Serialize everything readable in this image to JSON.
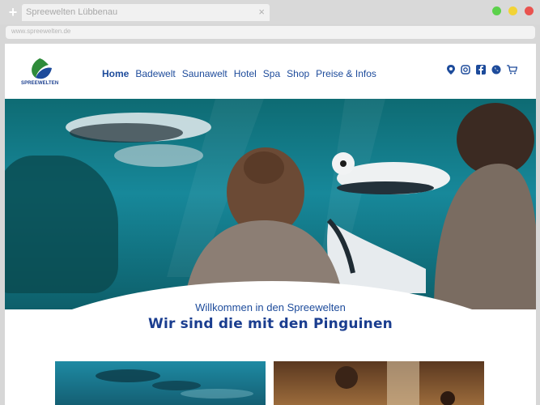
{
  "browser": {
    "tab_title": "Spreewelten Lübbenau",
    "tab_close": "×",
    "new_tab": "+",
    "url": "www.spreewelten.de",
    "controls": {
      "green": "#5bd14b",
      "yellow": "#f2d336",
      "red": "#e9534f"
    }
  },
  "site": {
    "logo_text": "SPREEWELTEN",
    "nav": [
      {
        "label": "Home",
        "active": true
      },
      {
        "label": "Badewelt",
        "active": false
      },
      {
        "label": "Saunawelt",
        "active": false
      },
      {
        "label": "Hotel",
        "active": false
      },
      {
        "label": "Spa",
        "active": false
      },
      {
        "label": "Shop",
        "active": false
      },
      {
        "label": "Preise & Infos",
        "active": false
      }
    ],
    "social_icons": [
      "map-pin-icon",
      "instagram-icon",
      "facebook-icon",
      "whatsapp-icon",
      "cart-icon"
    ],
    "welcome": "Willkommen in den Spreewelten",
    "tagline": "Wir sind die mit den Pinguinen",
    "accent_color": "#1d4b9b"
  }
}
